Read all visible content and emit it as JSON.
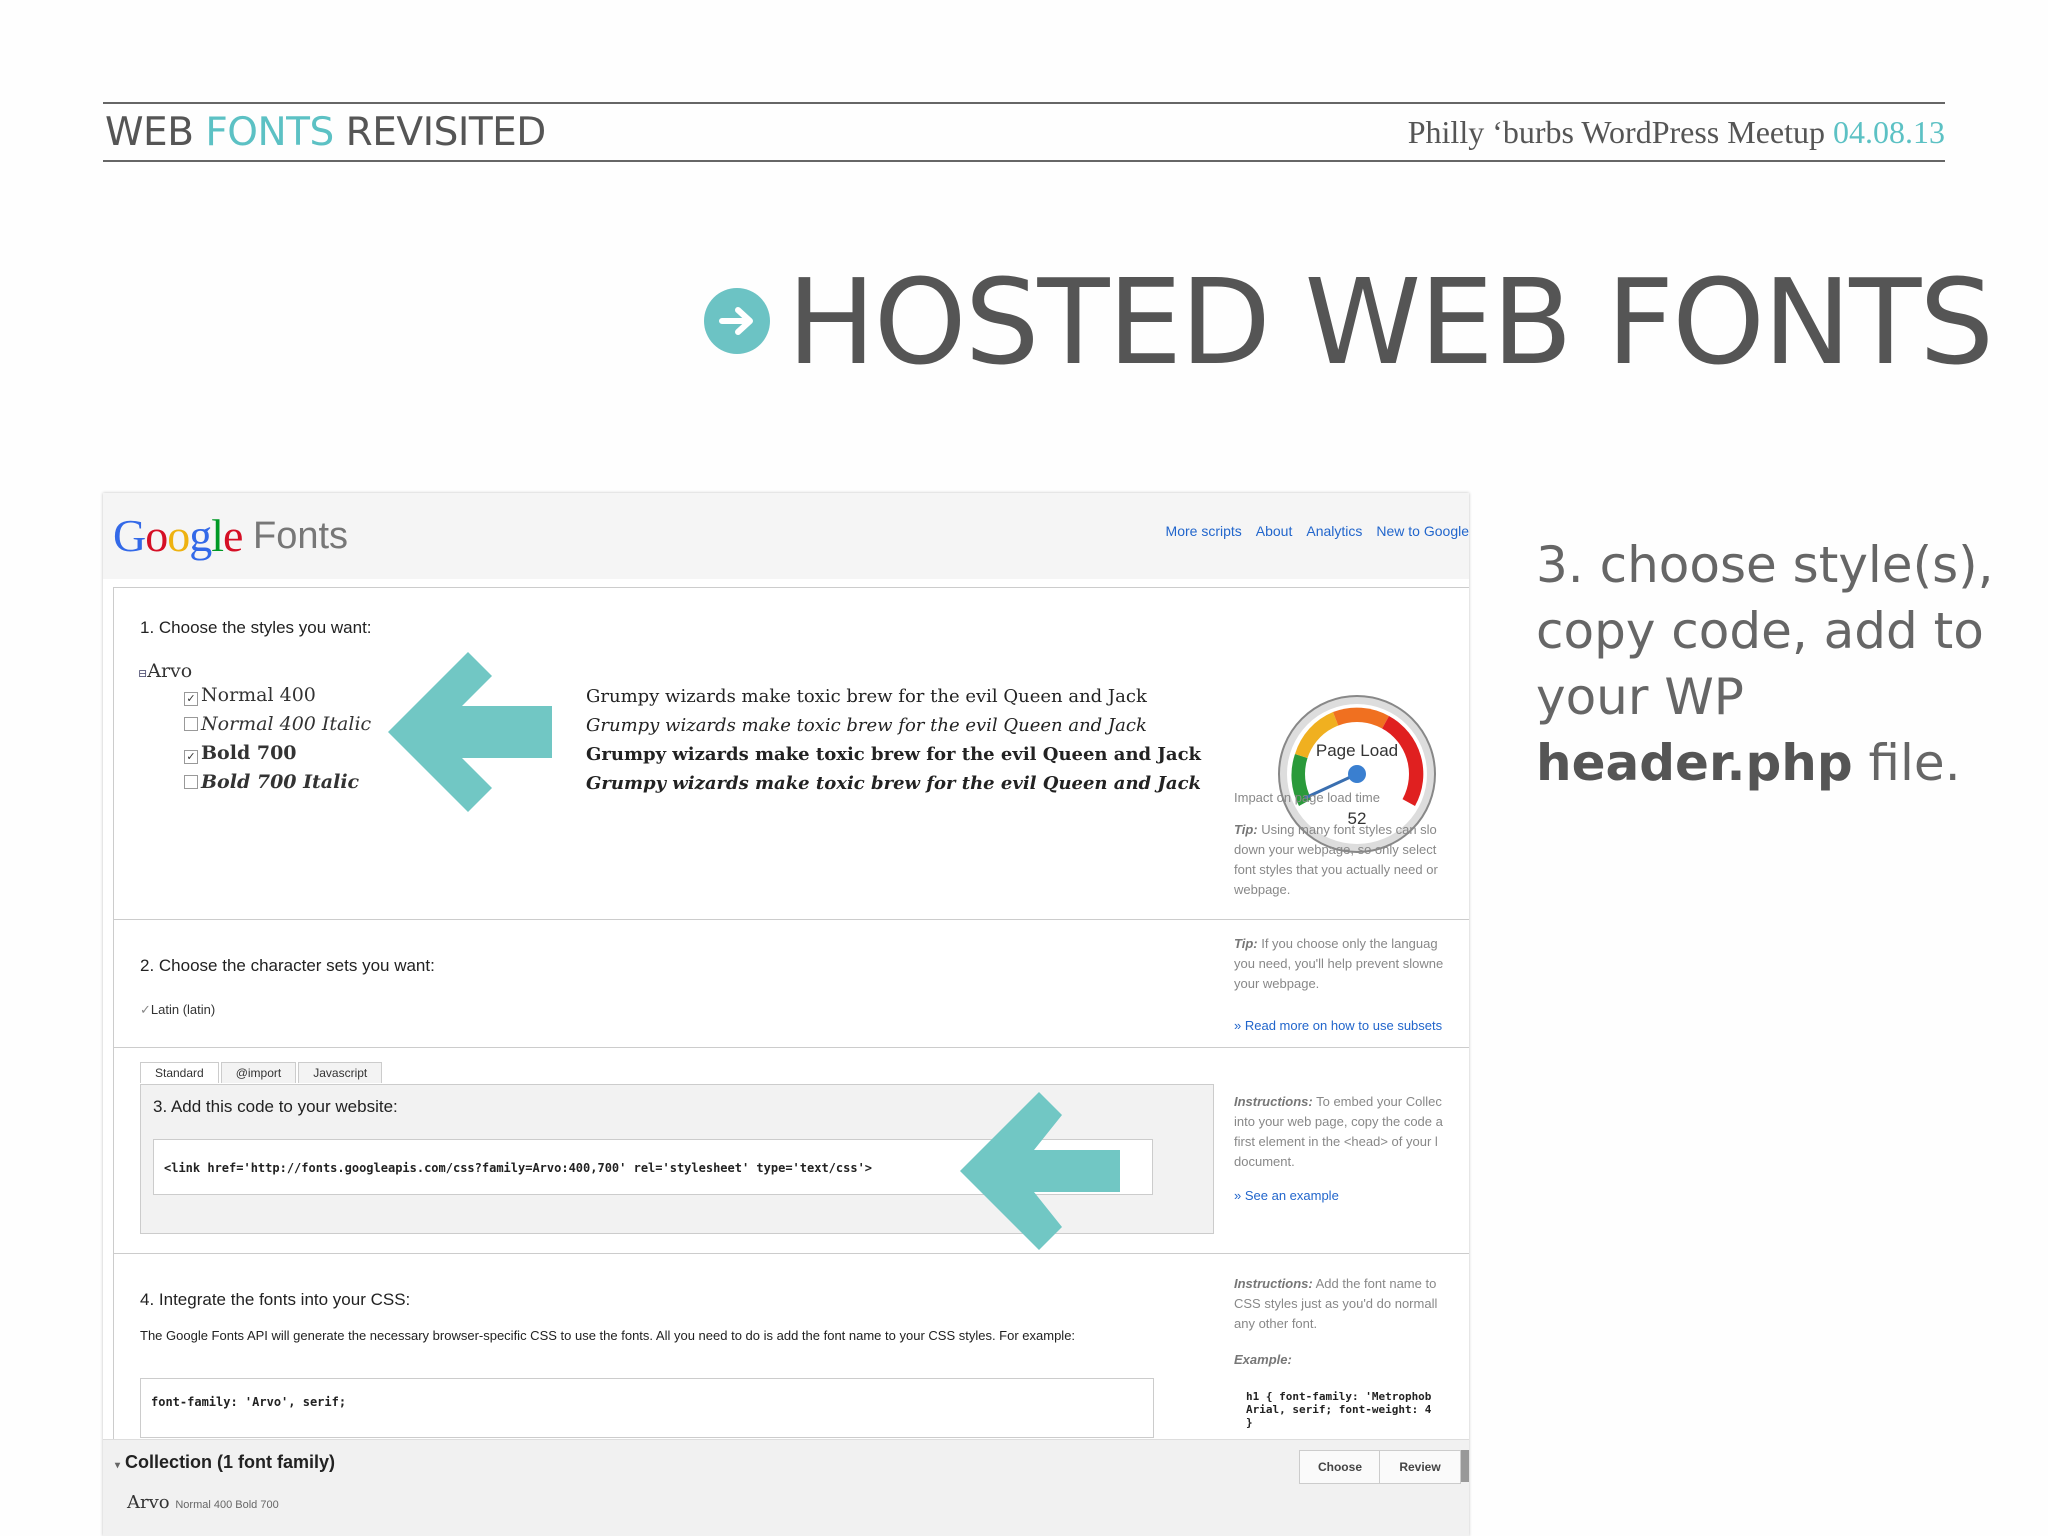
{
  "header": {
    "left_part1": "WEB ",
    "left_accent": "FONTS",
    "left_part2": " REVISITED",
    "right_text": "Philly ‘burbs WordPress Meetup ",
    "right_date": "04.08.13"
  },
  "slide": {
    "title": "HOSTED WEB FONTS",
    "icon": "arrow-right-circle-icon",
    "side_text_1": "3.  choose style(s), copy code, add to your WP ",
    "side_bold": "header.php",
    "side_text_2": " file."
  },
  "colors": {
    "accent": "#5cc1c4",
    "arrow": "#71c7c4",
    "link": "#2266cc"
  },
  "screenshot": {
    "logo": "Google",
    "product": "Fonts",
    "nav": [
      "More scripts",
      "About",
      "Analytics",
      "New to Google"
    ],
    "step1": {
      "heading": "1. Choose the styles you want:",
      "family": "Arvo",
      "options": [
        {
          "label": "Normal 400",
          "checked": true
        },
        {
          "label": "Normal 400 Italic",
          "checked": false
        },
        {
          "label": "Bold 700",
          "checked": true
        },
        {
          "label": "Bold 700 Italic",
          "checked": false
        }
      ],
      "sample": "Grumpy wizards make toxic brew for the evil Queen and Jack",
      "gauge_label": "Page Load",
      "gauge_value": "52",
      "impact": "Impact on page load time",
      "tip_label": "Tip:",
      "tip_lines": [
        " Using many font styles can slo",
        "down your webpage, so only select ",
        "font styles that you actually need or",
        "webpage."
      ]
    },
    "step2": {
      "heading": "2. Choose the character sets you want:",
      "charset": "Latin (latin)",
      "tip_label": "Tip:",
      "tip_lines": [
        " If you choose only the languag",
        "you need, you'll help prevent slowne",
        "your webpage."
      ],
      "link": "» Read more on how to use subsets"
    },
    "step3": {
      "tabs": [
        "Standard",
        "@import",
        "Javascript"
      ],
      "heading": "3. Add this code to your website:",
      "code": "<link href='http://fonts.googleapis.com/css?family=Arvo:400,700' rel='stylesheet' type='text/css'>",
      "instr_label": "Instructions:",
      "instr_lines": [
        " To embed your Collec",
        "into your web page, copy the code a",
        "first element in the <head> of your l",
        "document."
      ],
      "link": "» See an example"
    },
    "step4": {
      "heading": "4. Integrate the fonts into your CSS:",
      "desc": "The Google Fonts API will generate the necessary browser-specific CSS to use the fonts. All you need to do is add the font name to your CSS styles. For example:",
      "code": "font-family: 'Arvo', serif;",
      "instr_label": "Instructions:",
      "instr_lines": [
        " Add the font name to",
        "CSS styles just as you'd do normall",
        "any other font."
      ],
      "example_label": "Example:",
      "example_code": [
        "h1 { font-family: 'Metrophob",
        "Arial, serif; font-weight: 4",
        "}"
      ]
    },
    "collection": {
      "title": "Collection (1 font family)",
      "family": "Arvo",
      "styles": "Normal 400 Bold 700",
      "buttons": [
        "Choose",
        "Review"
      ]
    }
  }
}
